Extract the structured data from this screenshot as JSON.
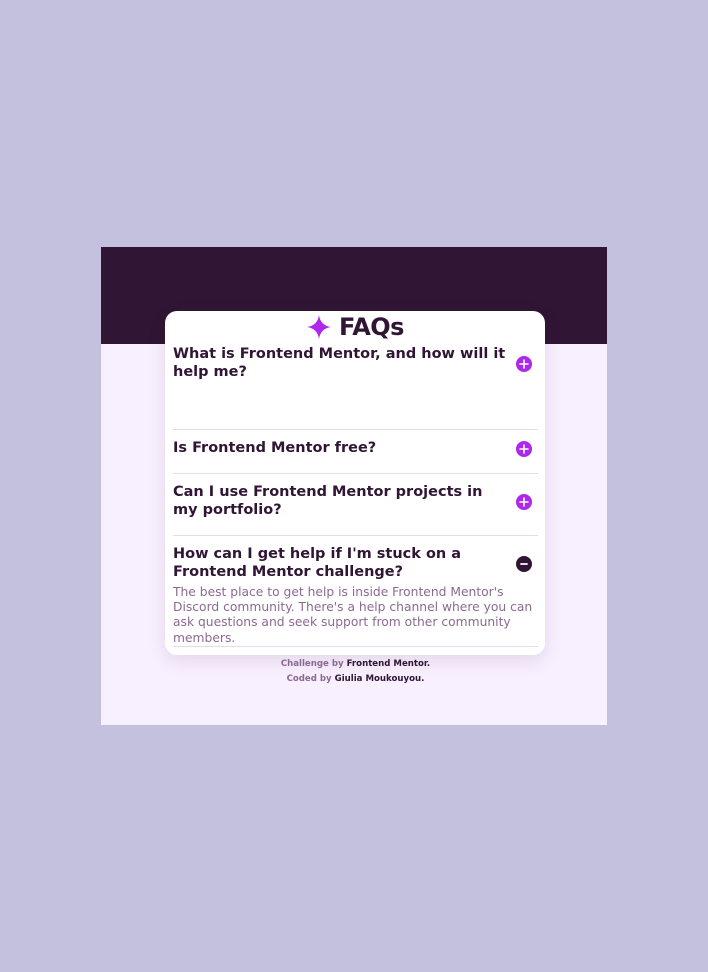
{
  "page": {
    "title": "FAQs"
  },
  "faqs": [
    {
      "question": "What is Frontend Mentor, and how will it help me?",
      "state": "collapsed"
    },
    {
      "question": "Is Frontend Mentor free?",
      "state": "collapsed"
    },
    {
      "question": "Can I use Frontend Mentor projects in my portfolio?",
      "state": "collapsed"
    },
    {
      "question": "How can I get help if I'm stuck on a Frontend Mentor challenge?",
      "state": "expanded",
      "answer": "The best place to get help is inside Frontend Mentor's Discord community. There's a help channel where you can ask questions and seek support from other community members."
    }
  ],
  "attribution": {
    "challenge_prefix": "Challenge by",
    "challenge_name": "Frontend Mentor.",
    "coded_prefix": "Coded by",
    "coded_name": "Giulia Moukouyou."
  },
  "icons": {
    "title_icon": "star-icon",
    "collapsed_icon": "plus-icon",
    "expanded_icon": "minus-icon"
  },
  "colors": {
    "background": "#c4c1df",
    "frame_top": "#301534",
    "frame_bottom": "#f8efff",
    "accent": "#ad28eb",
    "heading": "#301534",
    "body_text": "#8c6991"
  }
}
